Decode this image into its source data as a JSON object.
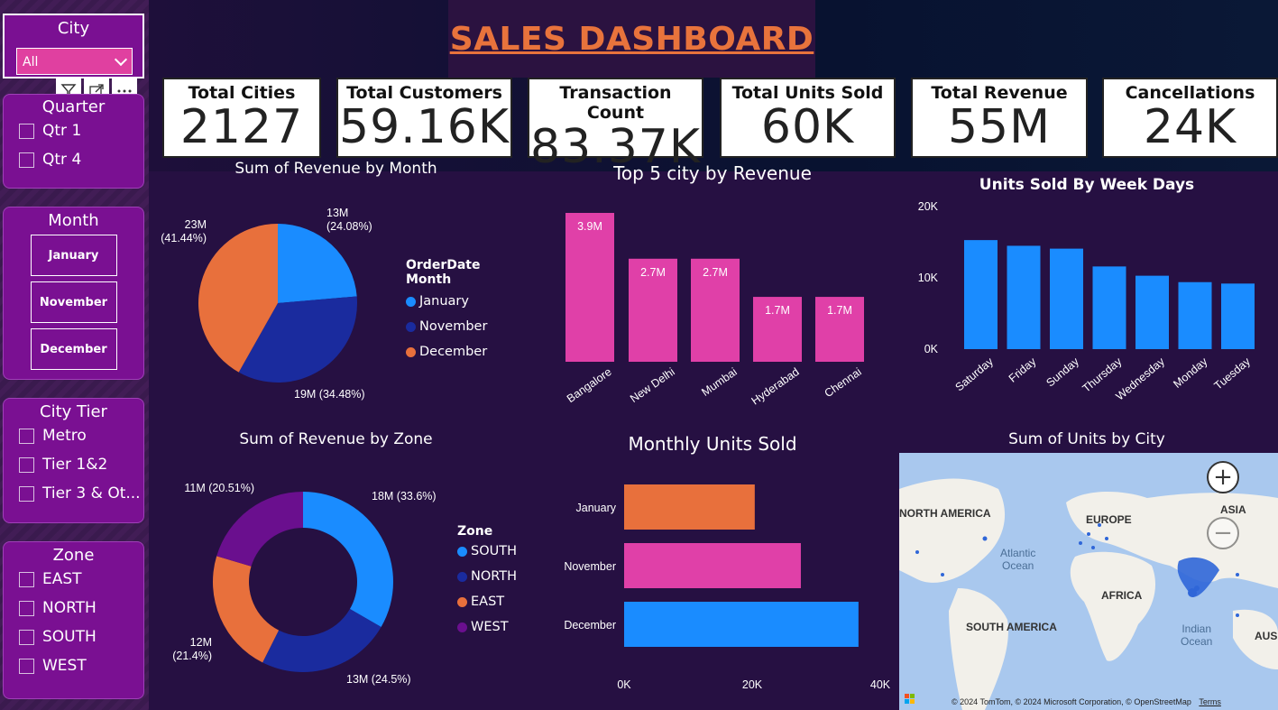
{
  "title": "SALES DASHBOARD",
  "colors": {
    "orange": "#e8703c",
    "blue": "#1a8cff",
    "navy": "#1a2b9e",
    "pink": "#e040a8",
    "purple": "#6a0f8e",
    "slicer": "#7a1092"
  },
  "slicers": {
    "city": {
      "title": "City",
      "value": "All"
    },
    "toolbar": [
      "filter-icon",
      "focus-mode-icon",
      "more-options-icon"
    ],
    "quarter": {
      "title": "Quarter",
      "options": [
        "Qtr 1",
        "Qtr 4"
      ]
    },
    "month": {
      "title": "Month",
      "options": [
        "January",
        "November",
        "December"
      ]
    },
    "city_tier": {
      "title": "City Tier",
      "options": [
        "Metro",
        "Tier 1&2",
        "Tier 3 & Ot..."
      ]
    },
    "zone": {
      "title": "Zone",
      "options": [
        "EAST",
        "NORTH",
        "SOUTH",
        "WEST"
      ]
    }
  },
  "kpis": [
    {
      "label": "Total Cities",
      "value": "2127"
    },
    {
      "label": "Total Customers",
      "value": "59.16K"
    },
    {
      "label": "Transaction Count",
      "value": "83.37K"
    },
    {
      "label": "Total Units Sold",
      "value": "60K"
    },
    {
      "label": "Total Revenue",
      "value": "55M"
    },
    {
      "label": "Cancellations",
      "value": "24K"
    }
  ],
  "chart_data": [
    {
      "type": "pie",
      "title": "Sum of Revenue by Month",
      "legend_title": "OrderDate Month",
      "legend_position": "right",
      "categories": [
        "January",
        "November",
        "December"
      ],
      "values": [
        13,
        19,
        23
      ],
      "percents": [
        24.08,
        34.48,
        41.44
      ],
      "labels": [
        "13M\n(24.08%)",
        "19M (34.48%)",
        "23M\n(41.44%)"
      ]
    },
    {
      "type": "bar",
      "title": "Top 5 city by Revenue",
      "categories": [
        "Bangalore",
        "New Delhi",
        "Mumbai",
        "Hyderabad",
        "Chennai"
      ],
      "values": [
        3.9,
        2.7,
        2.7,
        1.7,
        1.7
      ],
      "data_labels": [
        "3.9M",
        "2.7M",
        "2.7M",
        "1.7M",
        "1.7M"
      ],
      "unit": "M"
    },
    {
      "type": "bar",
      "title": "Units Sold By Week Days",
      "categories": [
        "Saturday",
        "Friday",
        "Sunday",
        "Thursday",
        "Wednesday",
        "Monday",
        "Tuesday"
      ],
      "values": [
        15.3,
        14.5,
        14.1,
        11.6,
        10.3,
        9.4,
        9.2
      ],
      "yticks": [
        "0K",
        "10K",
        "20K"
      ],
      "ylim": [
        0,
        20
      ]
    },
    {
      "type": "pie",
      "title": "Sum of Revenue by Zone",
      "legend_title": "Zone",
      "legend_position": "right",
      "categories": [
        "SOUTH",
        "NORTH",
        "EAST",
        "WEST"
      ],
      "values": [
        18,
        13,
        12,
        11
      ],
      "percents": [
        33.6,
        24.5,
        21.4,
        20.51
      ],
      "labels": [
        "18M (33.6%)",
        "13M (24.5%)",
        "12M\n(21.4%)",
        "11M (20.51%)"
      ]
    },
    {
      "type": "bar",
      "title": "Monthly Units Sold",
      "orientation": "horizontal",
      "categories": [
        "January",
        "November",
        "December"
      ],
      "values": [
        20.4,
        27.6,
        36.6
      ],
      "xticks": [
        "0K",
        "20K",
        "40K"
      ],
      "xlim": [
        0,
        40
      ]
    }
  ],
  "map": {
    "title": "Sum of Units by City",
    "labels": [
      "NORTH AMERICA",
      "EUROPE",
      "ASIA",
      "AFRICA",
      "SOUTH AMERICA",
      "AUS"
    ],
    "oceans": [
      "Atlantic\nOcean",
      "Indian\nOcean"
    ],
    "copyright": "© 2024 TomTom, © 2024 Microsoft Corporation, © OpenStreetMap",
    "terms": "Terms"
  }
}
